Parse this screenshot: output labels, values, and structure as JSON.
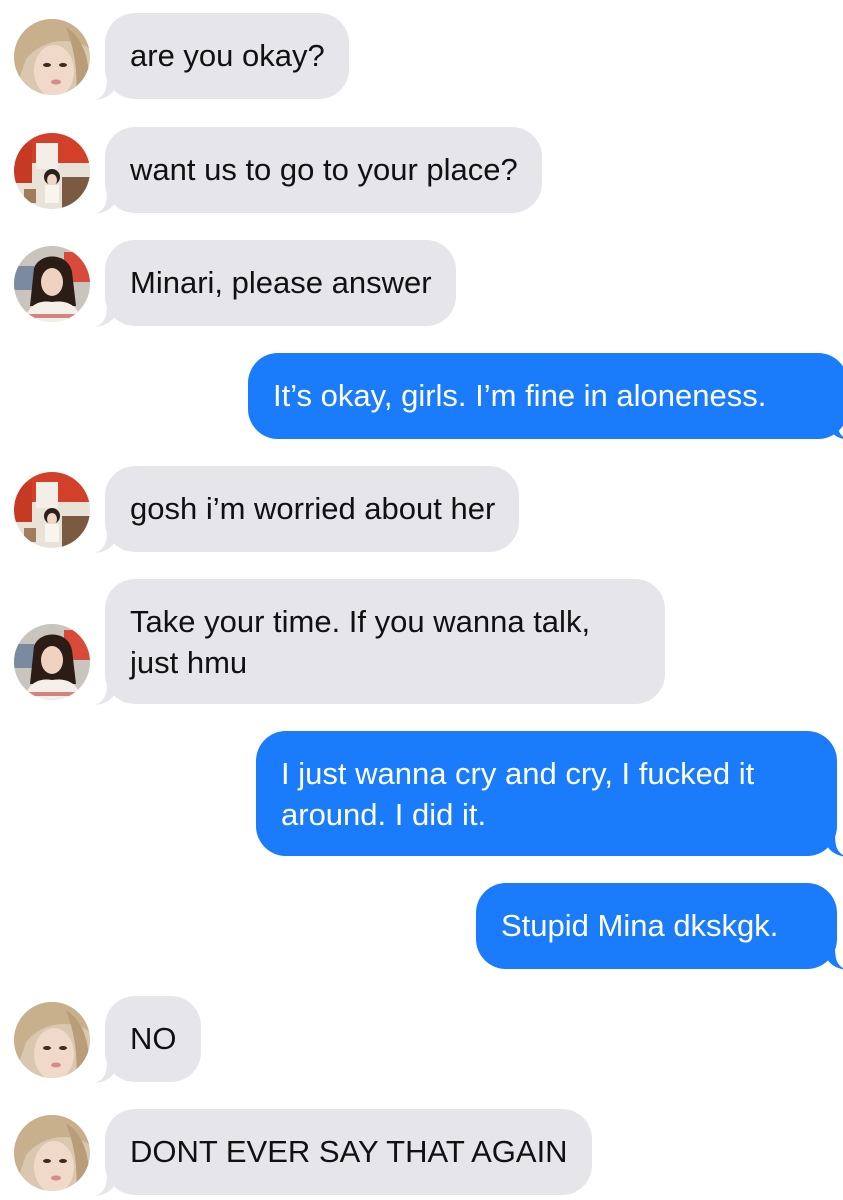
{
  "conversation": {
    "messages": [
      {
        "direction": "incoming",
        "sender": "blonde",
        "text": "are you okay?"
      },
      {
        "direction": "incoming",
        "sender": "redroom",
        "text": "want us to go to your place?"
      },
      {
        "direction": "incoming",
        "sender": "brunette",
        "text": "Minari, please answer"
      },
      {
        "direction": "outgoing",
        "text": "It’s okay, girls. I’m fine in aloneness."
      },
      {
        "direction": "incoming",
        "sender": "redroom",
        "text": "gosh i’m worried about her"
      },
      {
        "direction": "incoming",
        "sender": "brunette",
        "text": "Take your time. If you wanna talk, just hmu"
      },
      {
        "direction": "outgoing",
        "text": "I just wanna cry and cry, I fucked it around. I did it."
      },
      {
        "direction": "outgoing",
        "text": "Stupid Mina dkskgk."
      },
      {
        "direction": "incoming",
        "sender": "blonde",
        "text": "NO"
      },
      {
        "direction": "incoming",
        "sender": "blonde",
        "text": "DONT EVER SAY THAT AGAIN"
      }
    ]
  },
  "colors": {
    "incoming_bubble": "#e5e5ea",
    "outgoing_bubble": "#1a7cfa",
    "incoming_text": "#111111",
    "outgoing_text": "#ffffff"
  }
}
